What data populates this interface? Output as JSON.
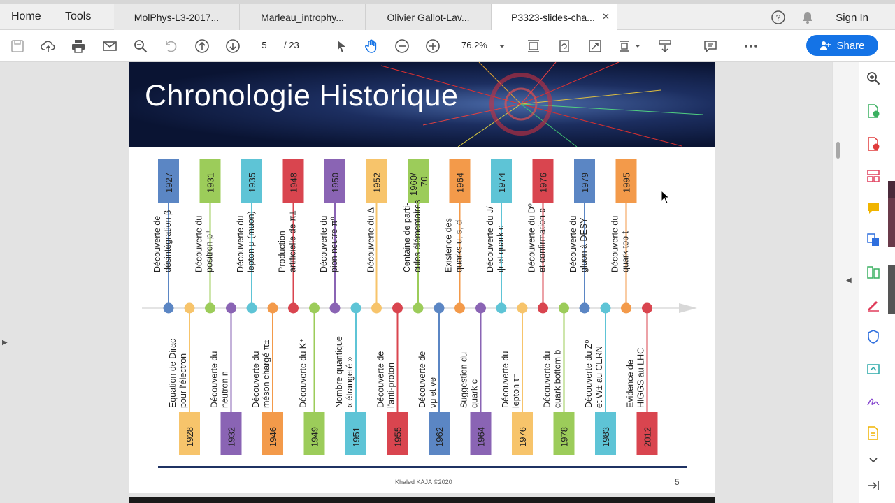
{
  "menu": {
    "home": "Home",
    "tools": "Tools"
  },
  "tabs": [
    {
      "label": "MolPhys-L3-2017..."
    },
    {
      "label": "Marleau_introphy..."
    },
    {
      "label": "Olivier Gallot-Lav..."
    },
    {
      "label": "P3323-slides-cha...",
      "active": true
    }
  ],
  "header": {
    "sign_in": "Sign In"
  },
  "toolbar": {
    "page_current": "5",
    "page_total": "/ 23",
    "zoom": "76.2%",
    "share": "Share"
  },
  "slide": {
    "title": "Chronologie Historique",
    "footer_author": "Khaled KAJA ©2020",
    "page_number": "5",
    "events_top": [
      {
        "year": "1927",
        "text1": "Découverte de",
        "text2": "désintégration β",
        "color": "#5b86c4"
      },
      {
        "year": "1931",
        "text1": "Découverte du",
        "text2": "positron p⁺",
        "color": "#9ccc5a"
      },
      {
        "year": "1935",
        "text1": "Découverte du",
        "text2": "lepton μ (muon)",
        "color": "#5ec4d6"
      },
      {
        "year": "1948",
        "text1": "Production",
        "text2": "artificielle de π±",
        "color": "#d9454f"
      },
      {
        "year": "1950",
        "text1": "Découverte du",
        "text2": "pion neutre π⁰",
        "color": "#8a64b4"
      },
      {
        "year": "1952",
        "text1": "Découverte du Δ",
        "text2": "",
        "color": "#f7c46b"
      },
      {
        "year": "1960/70",
        "text1": "Centaine de parti-",
        "text2": "cules élémentaires",
        "color": "#9ccc5a"
      },
      {
        "year": "1964",
        "text1": "Existence des",
        "text2": "quarks u, s, d",
        "color": "#f39a4a"
      },
      {
        "year": "1974",
        "text1": "Découverte du J/",
        "text2": "ψ et quark c",
        "color": "#5ec4d6"
      },
      {
        "year": "1976",
        "text1": "Découverte du D⁰",
        "text2": "et confirmation c",
        "color": "#d9454f"
      },
      {
        "year": "1979",
        "text1": "Découverte du",
        "text2": "gluon à DESY",
        "color": "#5b86c4"
      },
      {
        "year": "1995",
        "text1": "Découverte du",
        "text2": "quark top t",
        "color": "#f39a4a"
      }
    ],
    "events_bottom": [
      {
        "year": "1928",
        "text1": "Equation de Dirac",
        "text2": "pour l'électron",
        "color": "#f7c46b"
      },
      {
        "year": "1932",
        "text1": "Découverte du",
        "text2": "neutron n",
        "color": "#8a64b4"
      },
      {
        "year": "1946",
        "text1": "Découverte du",
        "text2": "méson chargé π±",
        "color": "#f39a4a"
      },
      {
        "year": "1949",
        "text1": "Découverte du K⁺",
        "text2": "",
        "color": "#9ccc5a"
      },
      {
        "year": "1951",
        "text1": "Nombre quantique",
        "text2": "« étrangeté »",
        "color": "#5ec4d6"
      },
      {
        "year": "1955",
        "text1": "Découverte de",
        "text2": "l'anti-proton",
        "color": "#d9454f"
      },
      {
        "year": "1962",
        "text1": "Découverte de",
        "text2": "νμ et νe",
        "color": "#5b86c4"
      },
      {
        "year": "1964",
        "text1": "Suggestion du",
        "text2": "quark c",
        "color": "#8a64b4"
      },
      {
        "year": "1976",
        "text1": "Découverte du",
        "text2": "lepton τ⁻",
        "color": "#f7c46b"
      },
      {
        "year": "1978",
        "text1": "Découverte du",
        "text2": "quark bottom b",
        "color": "#9ccc5a"
      },
      {
        "year": "1983",
        "text1": "Découverte du Z⁰",
        "text2": "et W± au CERN",
        "color": "#5ec4d6"
      },
      {
        "year": "2012",
        "text1": "Evidence de",
        "text2": "HIGGS au LHC",
        "color": "#d9454f"
      }
    ]
  }
}
